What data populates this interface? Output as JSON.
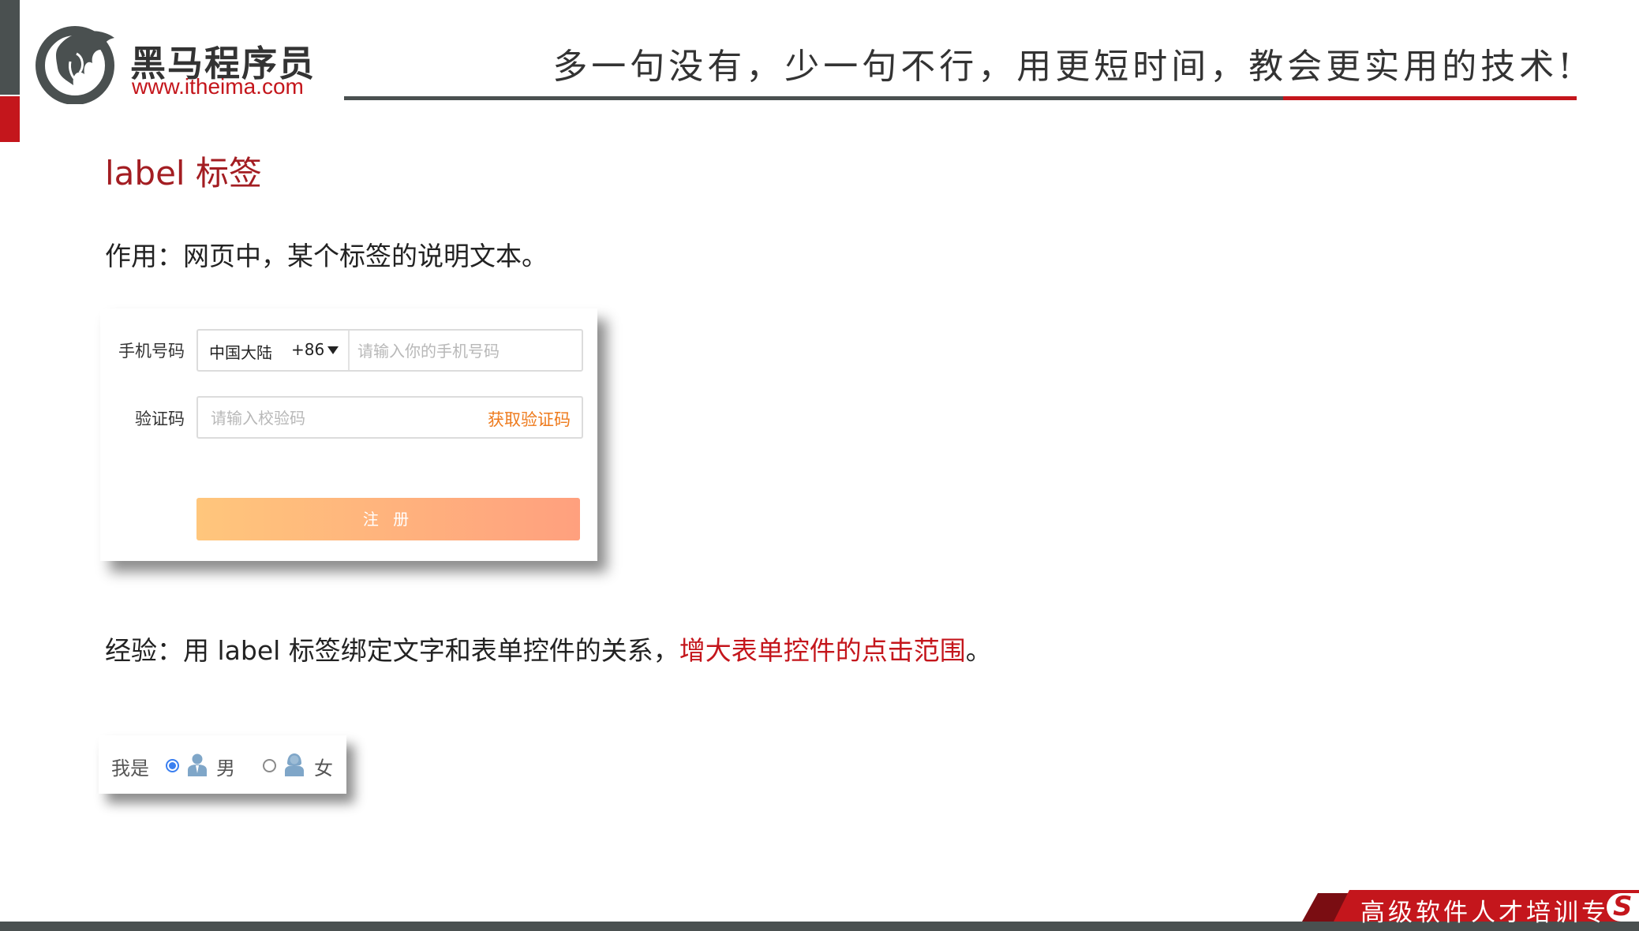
{
  "header": {
    "logo_name": "黑马程序员",
    "logo_url": "www.itheima.com",
    "slogan": "多一句没有，少一句不行，用更短时间，教会更实用的技术!"
  },
  "section": {
    "title": "label 标签",
    "purpose": "作用：网页中，某个标签的说明文本。",
    "experience_prefix": "经验：用 label 标签绑定文字和表单控件的关系，",
    "experience_highlight": "增大表单控件的点击范围",
    "experience_suffix": "。"
  },
  "signup_form": {
    "phone_label": "手机号码",
    "region": "中国大陆",
    "country_code": "+86",
    "phone_placeholder": "请输入你的手机号码",
    "code_label": "验证码",
    "code_placeholder": "请输入校验码",
    "get_code": "获取验证码",
    "register": "注 册"
  },
  "gender": {
    "label": "我是",
    "male": "男",
    "female": "女",
    "selected": "男"
  },
  "footer": {
    "text": "高级软件人才培训专"
  },
  "colors": {
    "brand_red": "#c4161c",
    "title_red": "#a31d22",
    "dark_gray": "#4a5050",
    "orange": "#ee7a1c"
  }
}
